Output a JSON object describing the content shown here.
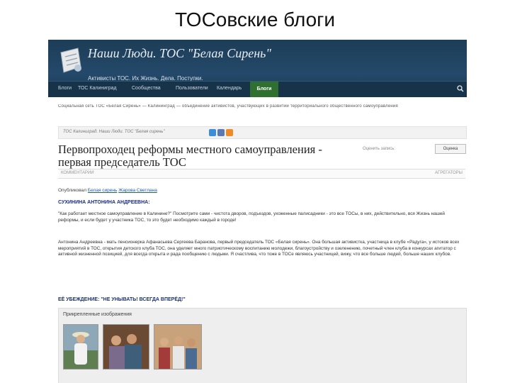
{
  "slide": {
    "title": "ТОСовские блоги"
  },
  "site": {
    "title": "Наши Люди. ТОС \"Белая Сирень\"",
    "tagline": "Активисты ТОС. Их Жизнь. Дела. Поступки.",
    "nav": [
      "Блоги",
      "ТОС Калиниград",
      "Сообщества",
      "Пользователи",
      "Календарь"
    ],
    "nav_active": "Блоги",
    "colors": {
      "banner": "#24496a",
      "nav_active": "#2f6f2f",
      "link": "#1f5aa6",
      "heading_blue": "#1a2f80"
    }
  },
  "notice": "Социальная сеть ТОС «Белая Сирень» — Калининград — объединение активистов, участвующих в развитии территориального общественного самоуправления",
  "breadcrumb": "ТОС Калиниград. Наши Люди. ТОС \"Белая сирень\"",
  "post": {
    "title": "Первопроходец реформы местного самоуправления - первая председатель ТОС",
    "rating_text": "Оценить запись:",
    "rating_button": "Оценка",
    "comments_label": "КОММЕНТАРИИ",
    "share_label": "АГРЕГАТОРЫ",
    "author_prefix": "Опубликовал",
    "author_link1": "Белая сирень",
    "author_link2": "Жарова Светлана",
    "author_name": "СУХИНИНА АНТОНИНА АНДРЕЕВНА:",
    "paragraph1": "\"Как работает местное самоуправление в Калинине?\" Посмотрите сами - чистота дворов, подъездов, ухоженные палисадники - это все ТОСы, в них, действительно, вся Жизнь нашей реформы, и если будет у участника ТОС, то это будет необходимо каждый в городе!",
    "paragraph2": "Антонина Андреевна - мать пенсионерка Афанасьева Сергеева Баранова, первый председатель ТОС «Белая сирень». Она большая активистка, участница в клубе «Радуга», у истоков всех мероприятий в ТОС, открытия детского клуба ТОС, она уделяет много патриотическому воспитанию молодежи, благоустройству и озеленению, почетный член клуба в конкурсах агитатор с активной жизненной позицией, для всегда открыта и рада пообщению с людьми. Я счастлива, что тоже в ТОСе являюсь участницей, вижу, что все больше людей, больше наших клубов.",
    "paragraph3": "",
    "motto": "ЕЁ УБЕЖДЕНИЕ: \"НЕ УНЫВАТЬ! ВСЕГДА ВПЕРЁД!\"",
    "images_label": "Прикрепленные изображения"
  }
}
